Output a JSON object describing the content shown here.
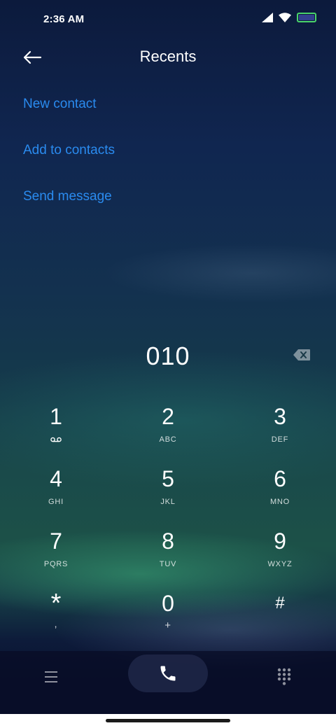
{
  "status_bar": {
    "time": "2:36 AM",
    "icons": [
      "signal-icon",
      "wifi-icon",
      "battery-icon"
    ],
    "battery_border_color": "#4ad36b"
  },
  "header": {
    "back_icon": "back-arrow-icon",
    "title": "Recents"
  },
  "actions": [
    {
      "label": "New contact"
    },
    {
      "label": "Add to contacts"
    },
    {
      "label": "Send message"
    }
  ],
  "colors": {
    "accent": "#2a8bef"
  },
  "dialer": {
    "number": "010",
    "backspace_icon": "backspace-icon"
  },
  "keypad": {
    "k1": {
      "digit": "1",
      "letters": "",
      "sub_icon": "voicemail-icon"
    },
    "k2": {
      "digit": "2",
      "letters": "ABC"
    },
    "k3": {
      "digit": "3",
      "letters": "DEF"
    },
    "k4": {
      "digit": "4",
      "letters": "GHI"
    },
    "k5": {
      "digit": "5",
      "letters": "JKL"
    },
    "k6": {
      "digit": "6",
      "letters": "MNO"
    },
    "k7": {
      "digit": "7",
      "letters": "PQRS"
    },
    "k8": {
      "digit": "8",
      "letters": "TUV"
    },
    "k9": {
      "digit": "9",
      "letters": "WXYZ"
    },
    "kstar": {
      "digit": "*",
      "letters": ","
    },
    "k0": {
      "digit": "0",
      "letters": "+"
    },
    "khash": {
      "digit": "#",
      "letters": ""
    }
  },
  "bottom_bar": {
    "menu_icon": "menu-icon",
    "call_icon": "phone-icon",
    "dialpad_icon": "dialpad-icon"
  }
}
